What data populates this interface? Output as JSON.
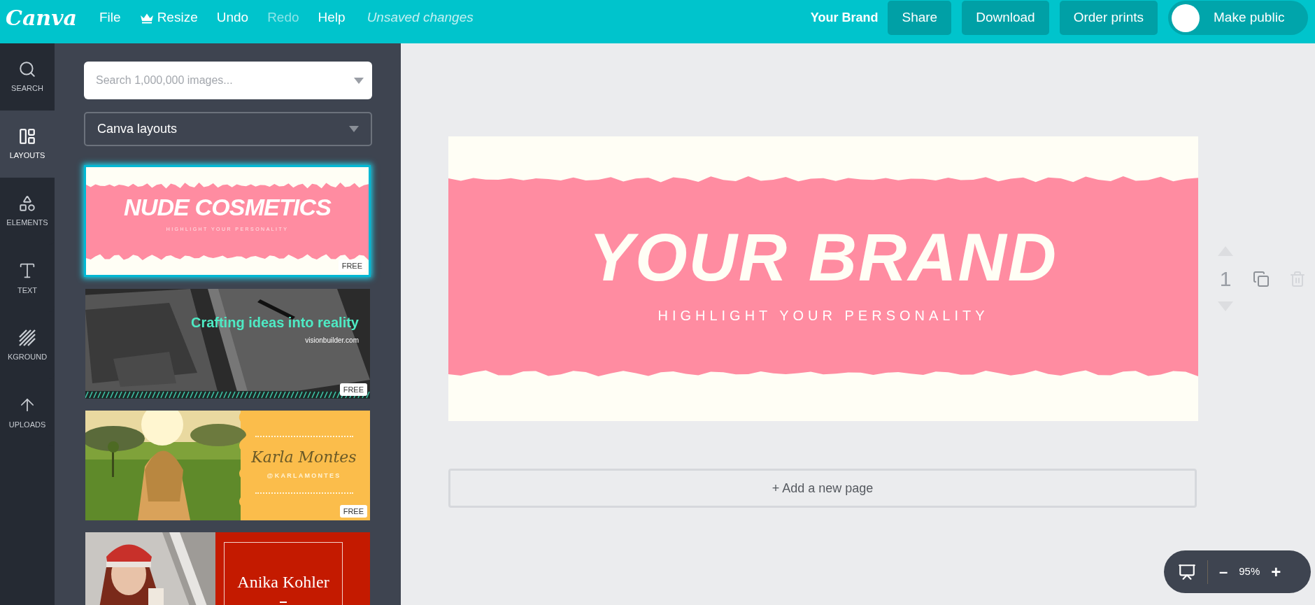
{
  "topbar": {
    "logo": "Canva",
    "menu": [
      {
        "label": "File",
        "disabled": false
      },
      {
        "label": "Resize",
        "disabled": false
      },
      {
        "label": "Undo",
        "disabled": false
      },
      {
        "label": "Redo",
        "disabled": true
      },
      {
        "label": "Help",
        "disabled": false
      }
    ],
    "status": "Unsaved changes",
    "brand": "Your Brand",
    "buttons": [
      "Share",
      "Download",
      "Order prints"
    ],
    "public_toggle": {
      "label": "Make public",
      "on": false
    }
  },
  "rail": [
    {
      "label": "SEARCH",
      "selected": false
    },
    {
      "label": "LAYOUTS",
      "selected": true
    },
    {
      "label": "ELEMENTS",
      "selected": false
    },
    {
      "label": "TEXT",
      "selected": false
    },
    {
      "label": "KGROUND",
      "selected": false
    },
    {
      "label": "UPLOADS",
      "selected": false
    }
  ],
  "panel": {
    "search": {
      "placeholder": "Search 1,000,000 images..."
    },
    "source": "Canva layouts",
    "layouts": [
      {
        "kind": "brush",
        "selected": true,
        "title": "NUDE COSMETICS",
        "subtitle": "HIGHLIGHT YOUR PERSONALITY",
        "badge": "FREE"
      },
      {
        "kind": "dark",
        "selected": false,
        "title": "Crafting ideas into reality",
        "subtitle": "visionbuilder.com",
        "badge": "FREE"
      },
      {
        "kind": "yellow",
        "selected": false,
        "title": "Karla Montes",
        "subtitle": "@KARLAMONTES",
        "badge": "FREE"
      },
      {
        "kind": "red",
        "selected": false,
        "title": "Anika Kohler"
      }
    ]
  },
  "canvas": {
    "title": "YOUR BRAND",
    "subtitle": "HIGHLIGHT YOUR PERSONALITY",
    "page_number": "1",
    "add_page": "+ Add a new page"
  },
  "zoom": {
    "minus": "–",
    "value": "95%",
    "plus": "+"
  }
}
